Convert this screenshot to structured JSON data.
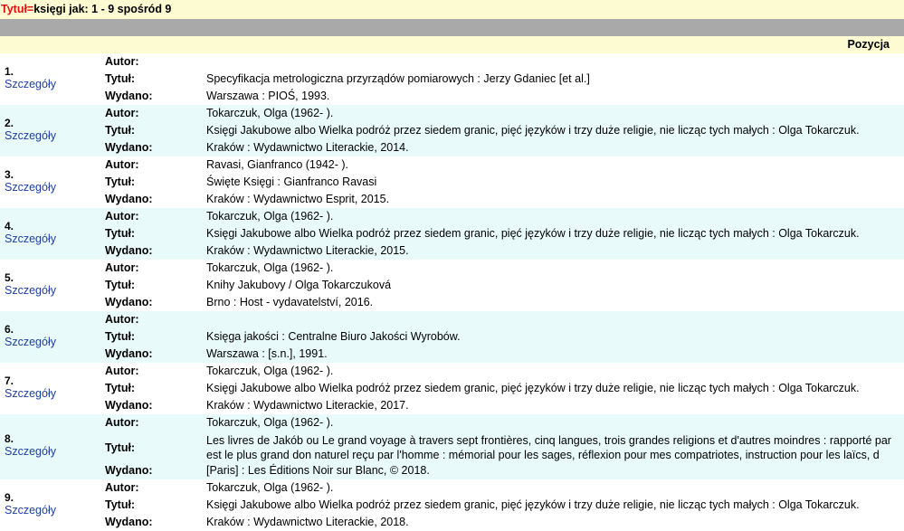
{
  "header": {
    "field": "Tytuł=",
    "summary": "księgi jak: 1 - 9 spośród 9"
  },
  "column": {
    "position": "Pozycja"
  },
  "labels": {
    "author": "Autor:",
    "title": "Tytuł:",
    "published": "Wydano:",
    "details": "Szczegóły"
  },
  "records": [
    {
      "num": "1.",
      "author": "",
      "title": "Specyfikacja metrologiczna przyrządów pomiarowych : Jerzy Gdaniec [et al.]",
      "published": "Warszawa : PIOŚ, 1993."
    },
    {
      "num": "2.",
      "author": "Tokarczuk, Olga (1962- ).",
      "title": "Księgi Jakubowe albo Wielka podróż przez siedem granic, pięć języków i trzy duże religie, nie licząc tych małych : Olga Tokarczuk.",
      "published": "Kraków : Wydawnictwo Literackie, 2014."
    },
    {
      "num": "3.",
      "author": "Ravasi, Gianfranco (1942- ).",
      "title": "Święte Księgi : Gianfranco Ravasi",
      "published": "Kraków : Wydawnictwo Esprit, 2015."
    },
    {
      "num": "4.",
      "author": "Tokarczuk, Olga (1962- ).",
      "title": "Księgi Jakubowe albo Wielka podróż przez siedem granic, pięć języków i trzy duże religie, nie licząc tych małych : Olga Tokarczuk.",
      "published": "Kraków : Wydawnictwo Literackie, 2015."
    },
    {
      "num": "5.",
      "author": "Tokarczuk, Olga (1962- ).",
      "title": "Knihy Jakubovy / Olga Tokarczuková",
      "published": "Brno : Host - vydavatelství, 2016."
    },
    {
      "num": "6.",
      "author": "",
      "title": "Księga jakości : Centralne Biuro Jakości Wyrobów.",
      "published": "Warszawa : [s.n.], 1991."
    },
    {
      "num": "7.",
      "author": "Tokarczuk, Olga (1962- ).",
      "title": "Księgi Jakubowe albo Wielka podróż przez siedem granic, pięć języków i trzy duże religie, nie licząc tych małych : Olga Tokarczuk.",
      "published": "Kraków : Wydawnictwo Literackie, 2017."
    },
    {
      "num": "8.",
      "author": "Tokarczuk, Olga (1962- ).",
      "title": "Les livres de Jakób ou Le grand voyage à travers sept frontières, cinq langues, trois grandes religions et d'autres moindres : rapporté par",
      "title2": "est le plus grand don naturel reçu par l'homme : mémorial pour les sages, réflexion pour mes compatriotes, instruction pour les laïcs, d",
      "published": "[Paris] : Les Éditions Noir sur Blanc, © 2018."
    },
    {
      "num": "9.",
      "author": "Tokarczuk, Olga (1962- ).",
      "title": "Księgi Jakubowe albo Wielka podróż przez siedem granic, pięć języków i trzy duże religie, nie licząc tych małych : Olga Tokarczuk.",
      "published": "Kraków : Wydawnictwo Literackie, 2018."
    }
  ]
}
